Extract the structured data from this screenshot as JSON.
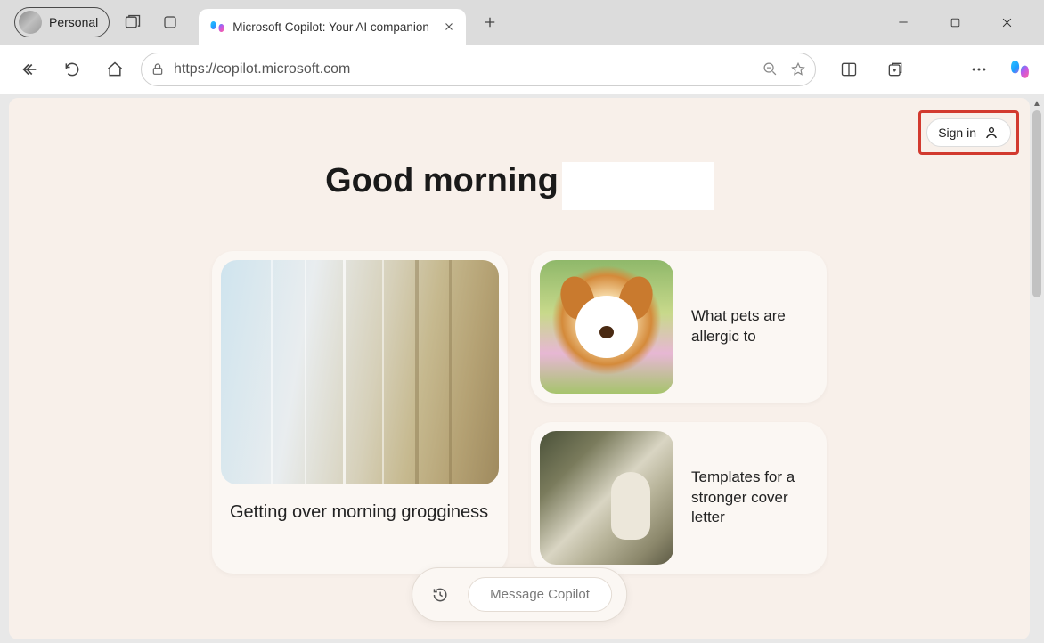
{
  "browser": {
    "profile_label": "Personal",
    "tab_title": "Microsoft Copilot: Your AI companion",
    "url": "https://copilot.microsoft.com"
  },
  "page": {
    "signin_label": "Sign in",
    "greeting": "Good morning",
    "cards": {
      "big": {
        "title": "Getting over morning grogginess"
      },
      "small1": {
        "title": "What pets are allergic to"
      },
      "small2": {
        "title": "Templates for a stronger cover letter"
      }
    },
    "composer_placeholder": "Message Copilot"
  },
  "highlight": {
    "target": "sign-in-button",
    "color": "#d23a2f"
  }
}
